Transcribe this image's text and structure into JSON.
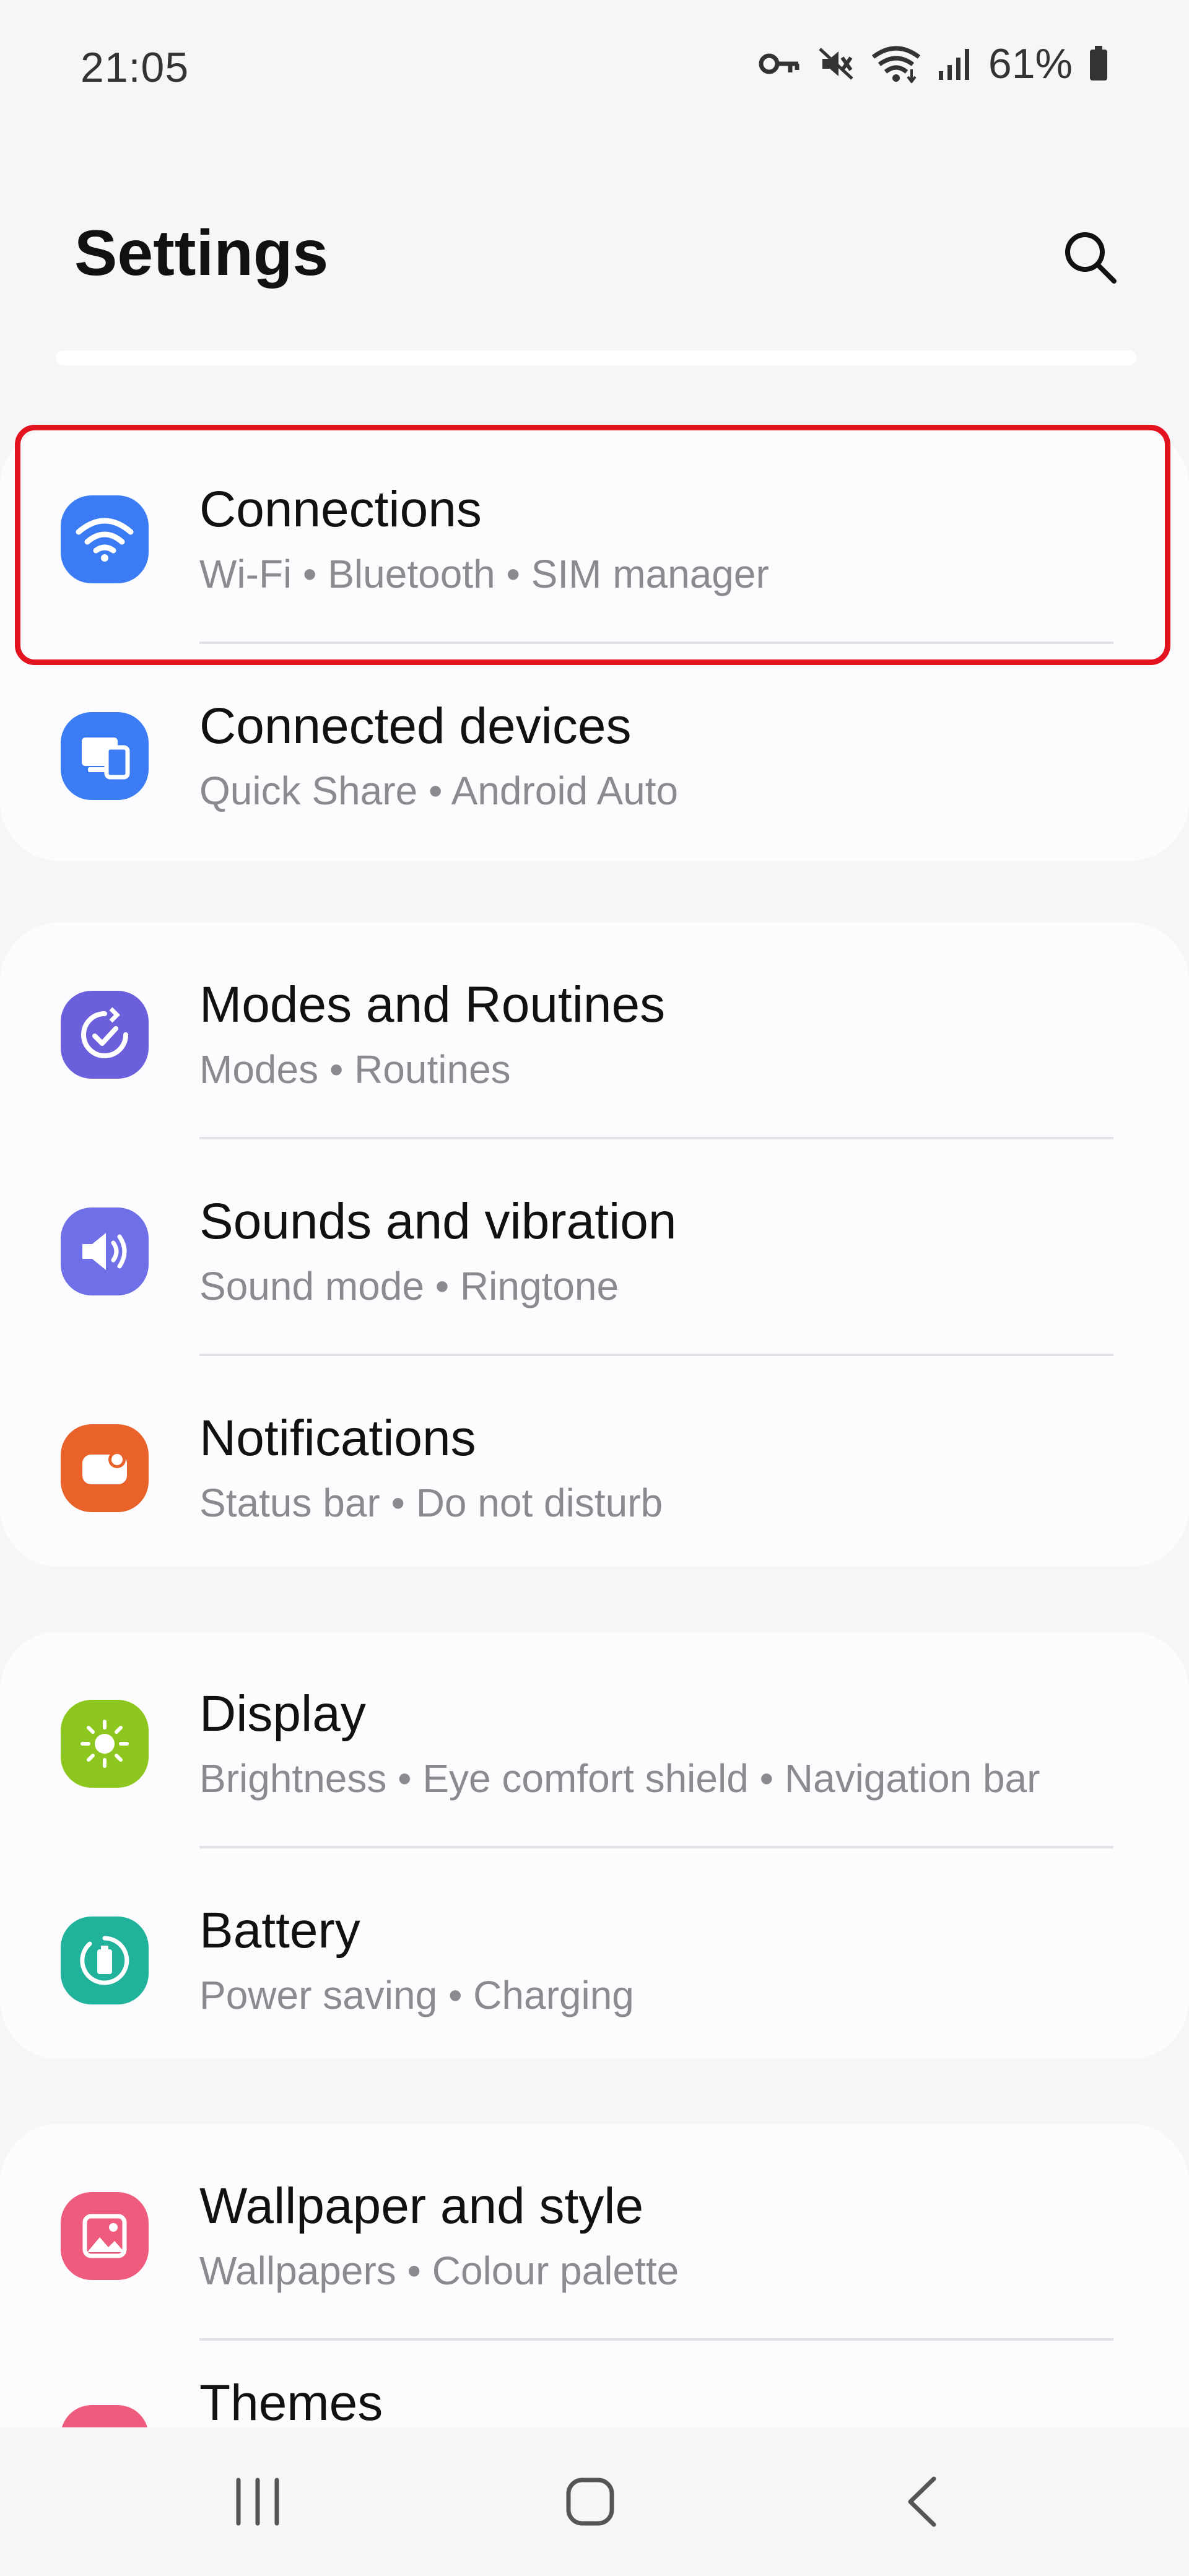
{
  "status_bar": {
    "time": "21:05",
    "battery": "61%",
    "icons": [
      "vpn-key-icon",
      "mute-icon",
      "wifi-icon",
      "signal-icon",
      "battery-icon"
    ]
  },
  "header": {
    "title": "Settings",
    "search_icon": "search-icon"
  },
  "colors": {
    "connections": "#3b7cf5",
    "connected_devices": "#3b7cf5",
    "modes": "#6b5fdc",
    "sounds": "#6f6fe8",
    "notifications": "#e8622a",
    "display": "#8cc61f",
    "battery": "#20b29a",
    "wallpaper": "#ef5b7d",
    "highlight": "#e3141f"
  },
  "groups": [
    {
      "items": [
        {
          "title": "Connections",
          "subtitle": "Wi-Fi  •  Bluetooth  •  SIM manager",
          "icon": "wifi-icon"
        },
        {
          "title": "Connected devices",
          "subtitle": "Quick Share  •  Android Auto",
          "icon": "connected-devices-icon"
        }
      ]
    },
    {
      "items": [
        {
          "title": "Modes and Routines",
          "subtitle": "Modes  •  Routines",
          "icon": "modes-routines-icon"
        },
        {
          "title": "Sounds and vibration",
          "subtitle": "Sound mode  •  Ringtone",
          "icon": "speaker-icon"
        },
        {
          "title": "Notifications",
          "subtitle": "Status bar  •  Do not disturb",
          "icon": "notifications-icon"
        }
      ]
    },
    {
      "items": [
        {
          "title": "Display",
          "subtitle": "Brightness  •  Eye comfort shield  •  Navigation bar",
          "icon": "sun-icon"
        },
        {
          "title": "Battery",
          "subtitle": "Power saving  •  Charging",
          "icon": "battery-care-icon"
        }
      ]
    },
    {
      "items": [
        {
          "title": "Wallpaper and style",
          "subtitle": "Wallpapers  •  Colour palette",
          "icon": "wallpaper-icon"
        },
        {
          "title": "Themes",
          "subtitle": "",
          "icon": "themes-icon"
        }
      ]
    }
  ],
  "nav_bar": {
    "recents": "recents-icon",
    "home": "home-icon",
    "back": "back-icon"
  }
}
